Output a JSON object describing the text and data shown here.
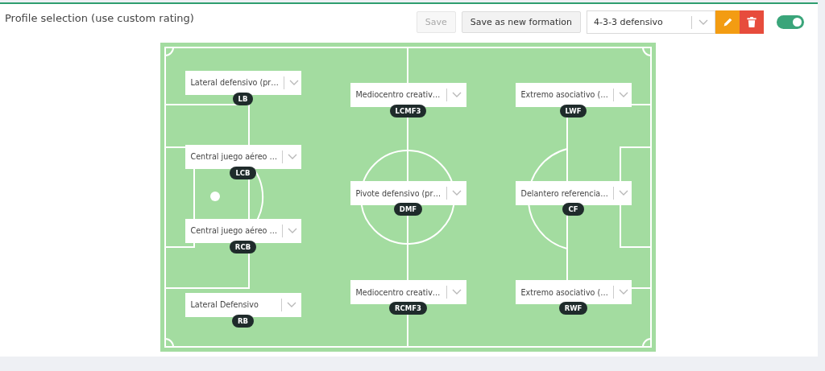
{
  "title": "Profile selection (use custom rating)",
  "save_button": {
    "label": "Save",
    "disabled": true
  },
  "save_as_button": {
    "label": "Save as new formation",
    "disabled": false
  },
  "formation_select": {
    "value": "4-3-3 defensivo"
  },
  "toggle": {
    "on": true
  },
  "lines": [
    [
      {
        "role": "Lateral defensivo (pr…",
        "position": "LB"
      },
      {
        "role": "Central juego aéreo …",
        "position": "LCB"
      },
      {
        "role": "Central juego aéreo …",
        "position": "RCB"
      },
      {
        "role": "Lateral Defensivo",
        "position": "RB"
      }
    ],
    [
      {
        "role": "Mediocentro creativ…",
        "position": "LCMF3"
      },
      {
        "role": "Pivote defensivo (pr…",
        "position": "DMF"
      },
      {
        "role": "Mediocentro creativ…",
        "position": "RCMF3"
      }
    ],
    [
      {
        "role": "Extremo asociativo (…",
        "position": "LWF"
      },
      {
        "role": "Delantero referencia…",
        "position": "CF"
      },
      {
        "role": "Extremo asociativo (…",
        "position": "RWF"
      }
    ]
  ]
}
